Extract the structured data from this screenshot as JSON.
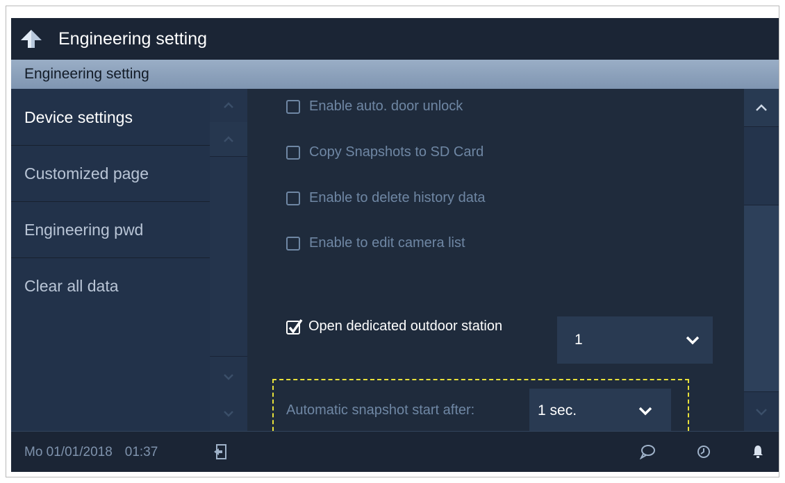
{
  "header": {
    "title": "Engineering setting"
  },
  "section": {
    "title": "Engineering setting"
  },
  "menu": {
    "items": [
      {
        "label": "Device settings"
      },
      {
        "label": "Customized page"
      },
      {
        "label": "Engineering pwd"
      },
      {
        "label": "Clear all data"
      }
    ]
  },
  "options": {
    "checkboxes": [
      {
        "label": "Enable auto. door unlock",
        "checked": false
      },
      {
        "label": "Copy Snapshots to SD Card",
        "checked": false
      },
      {
        "label": "Enable to delete history data",
        "checked": false
      },
      {
        "label": "Enable to edit camera list",
        "checked": false
      }
    ],
    "dedicated": {
      "label": "Open dedicated outdoor station",
      "checked": true,
      "value": "1"
    },
    "snapshot": {
      "label": "Automatic snapshot start after:",
      "value": "1 sec."
    }
  },
  "statusbar": {
    "date": "Mo 01/01/2018",
    "time": "01:37"
  },
  "colors": {
    "background": "#1f2b3c",
    "header": "#9aaec6",
    "highlight": "#e9e23a",
    "muted_text": "#6f87a4"
  },
  "icons": [
    "back-arrow-icon",
    "chevron-up-icon",
    "chevron-down-icon",
    "check-icon",
    "logout-icon",
    "message-icon",
    "clock-icon",
    "bell-icon"
  ]
}
